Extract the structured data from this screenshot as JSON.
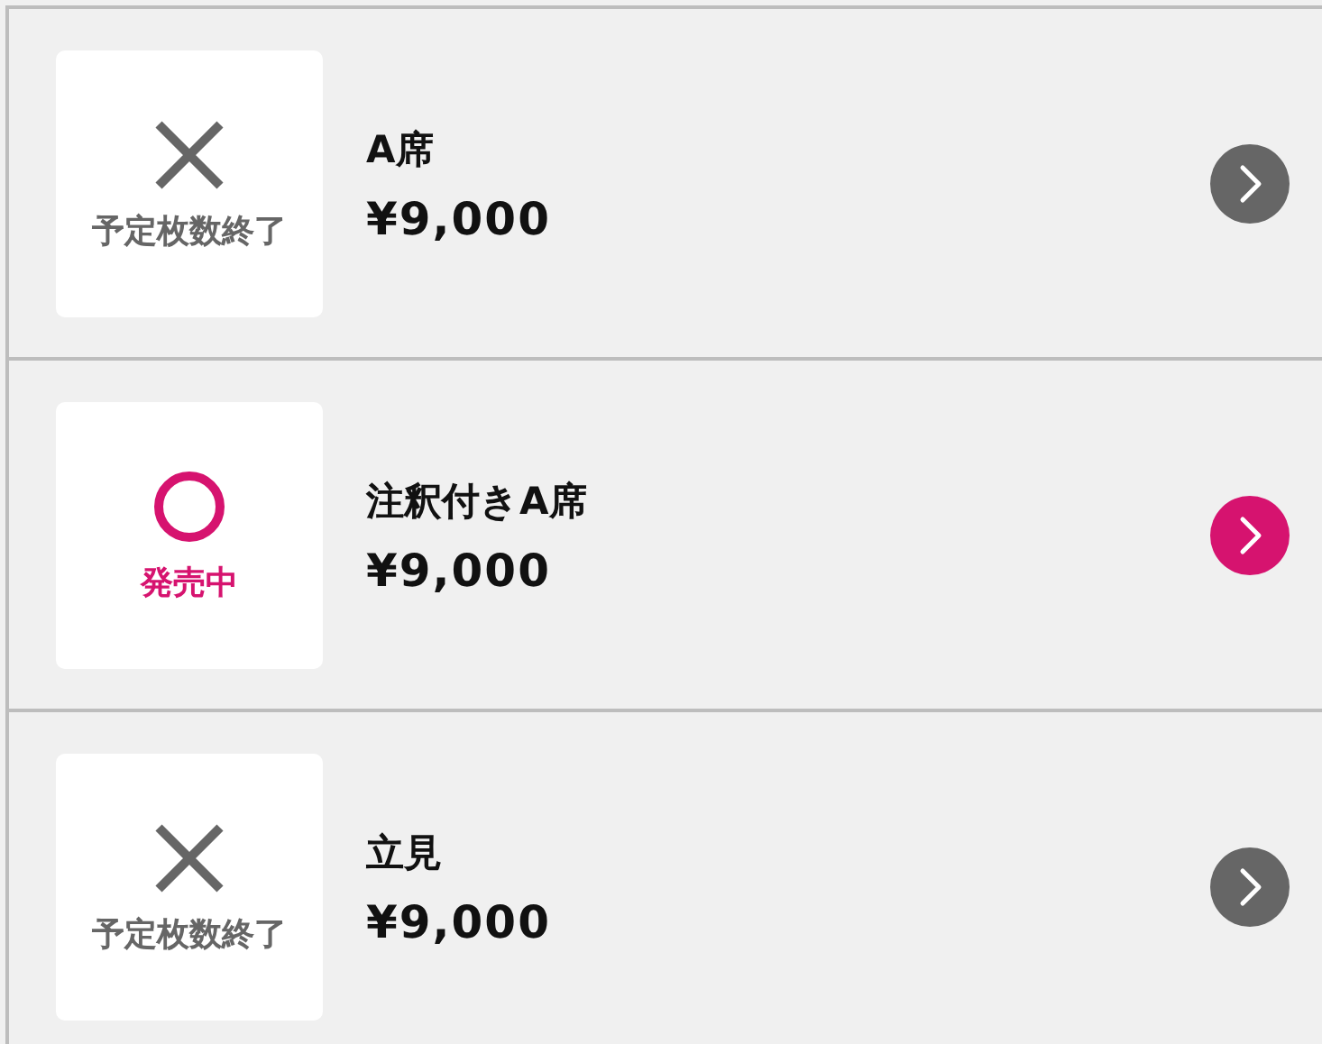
{
  "seats": [
    {
      "kind": "sold_out",
      "status": "予定枚数終了",
      "name": "A席",
      "price": "¥9,000"
    },
    {
      "kind": "on_sale",
      "status": "発売中",
      "name": "注釈付きA席",
      "price": "¥9,000"
    },
    {
      "kind": "sold_out",
      "status": "予定枚数終了",
      "name": "立見",
      "price": "¥9,000"
    }
  ]
}
